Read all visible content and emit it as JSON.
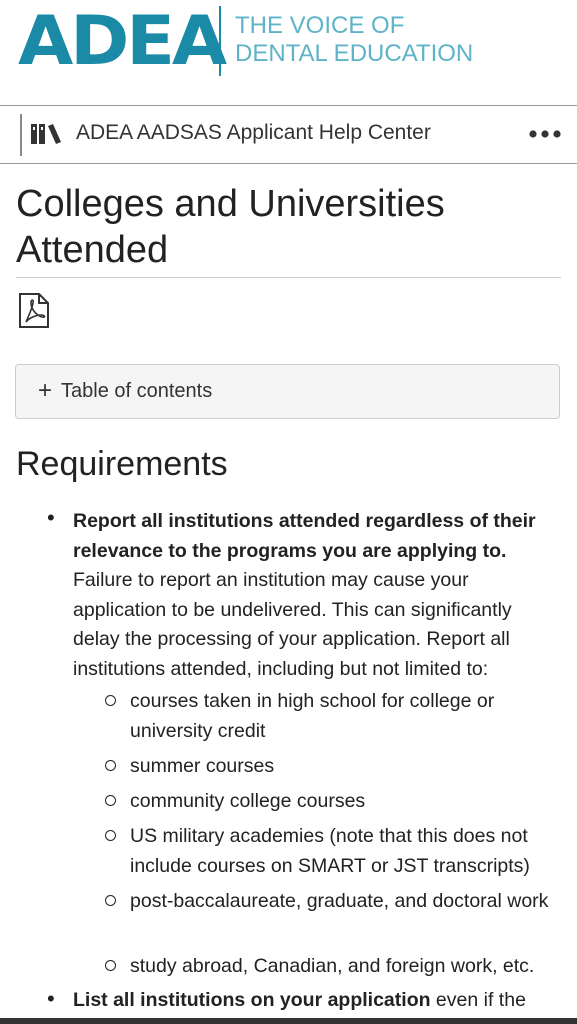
{
  "logo": {
    "wordmark": "ADEA",
    "tagline_line1": "THE VOICE OF",
    "tagline_line2": "DENTAL EDUCATION",
    "color": "#1b8aa6"
  },
  "help_bar": {
    "icon": "books-icon",
    "title": "ADEA AADSAS Applicant Help Center",
    "menu_icon": "more-icon"
  },
  "page": {
    "title": "Colleges and Universities Attended",
    "pdf_icon": "pdf-icon",
    "toc": {
      "icon": "+",
      "label": "Table of contents"
    },
    "section_heading": "Requirements"
  },
  "requirements": [
    {
      "bold": "Report all institutions attended regardless of their relevance to the programs you are applying to.",
      "text": " Failure to report an institution may cause your application to be undelivered. This can significantly delay the processing of your application. Report all institutions attended, including but not limited to:",
      "subitems": [
        "courses taken in high school for college or university credit",
        "summer courses",
        "community college courses",
        "US military academies (note that this does not include courses on SMART or JST transcripts)",
        "post-baccalaureate, graduate, and doctoral work",
        "study abroad, Canadian, and foreign work, etc."
      ]
    },
    {
      "bold": "List all institutions on your application",
      "text": " even if the"
    }
  ]
}
